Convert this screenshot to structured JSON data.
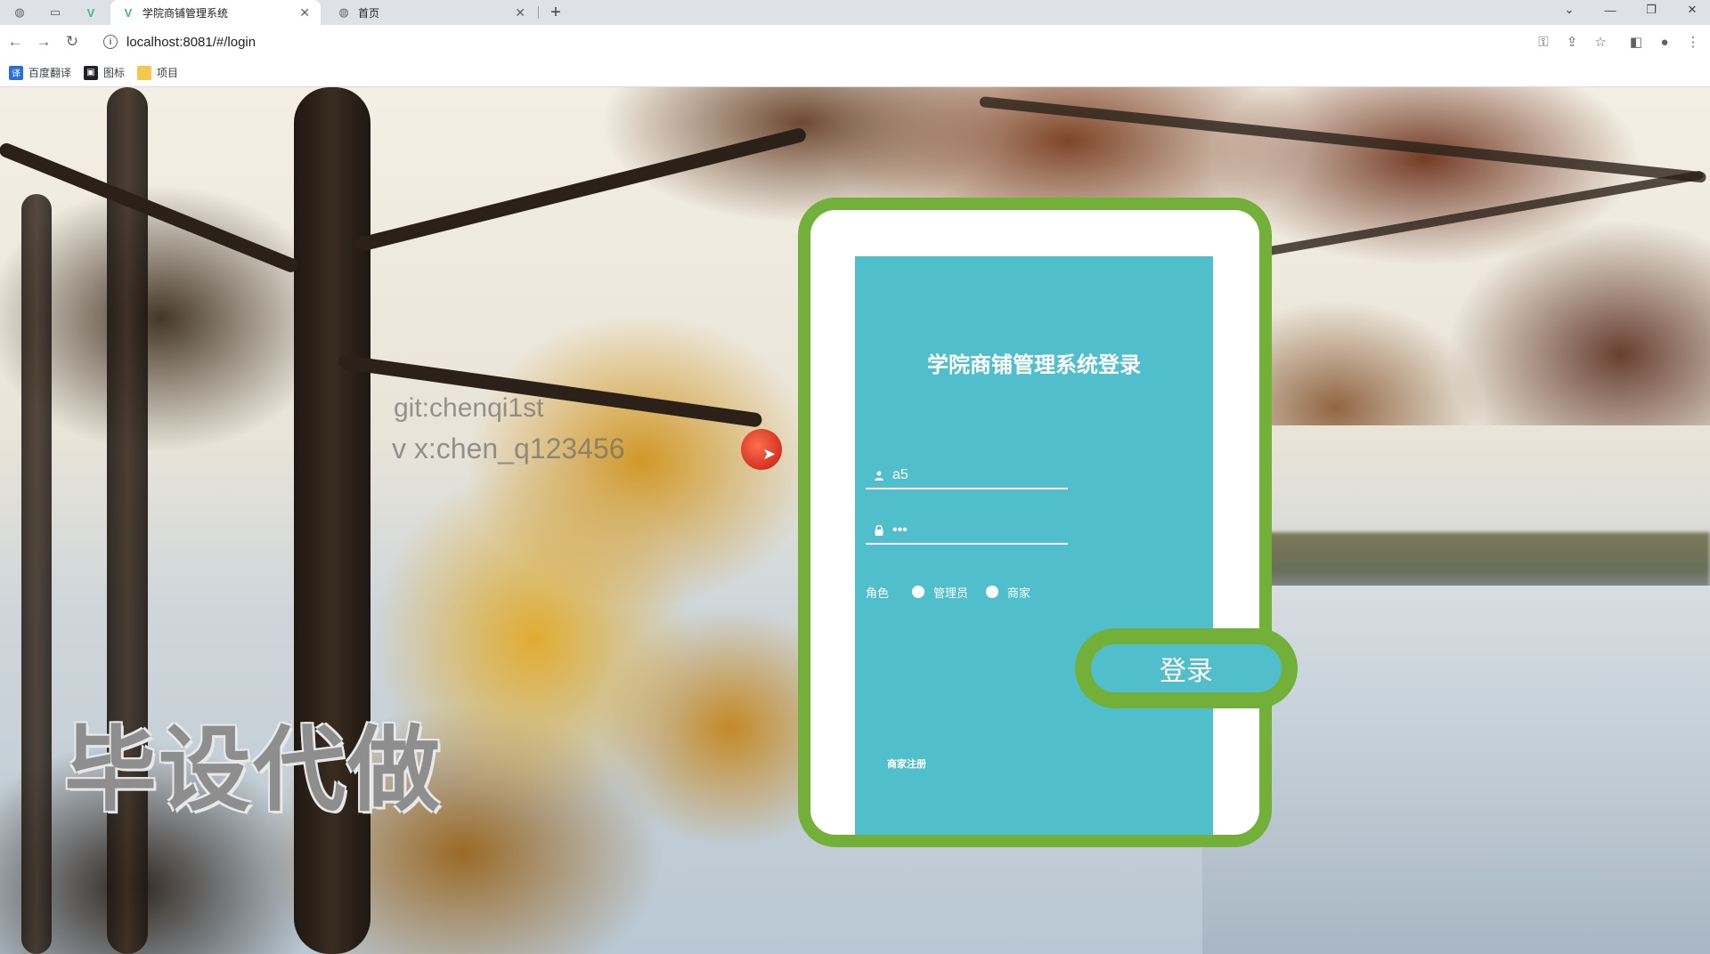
{
  "browser": {
    "tabs": [
      {
        "title": "学院商铺管理系统",
        "active": true
      },
      {
        "title": "首页",
        "active": false
      }
    ],
    "address": "localhost:8081/#/login",
    "bookmarks": [
      {
        "label": "百度翻译",
        "icon": "translate-icon",
        "color": "#2b6fd6"
      },
      {
        "label": "图标",
        "icon": "image-icon",
        "color": "#202124"
      },
      {
        "label": "项目",
        "icon": "folder-icon",
        "color": "#f2c94c"
      }
    ]
  },
  "watermark": {
    "line1": "git:chenqi1st",
    "line2": "v x:chen_q123456",
    "big": "毕设代做"
  },
  "login": {
    "title": "学院商铺管理系统登录",
    "username_value": "a5",
    "password_value": "123",
    "role_label": "角色",
    "roles": [
      "管理员",
      "商家"
    ],
    "submit_label": "登录",
    "register_label": "商家注册"
  },
  "colors": {
    "card_border": "#72b03a",
    "card_fill": "#51bfcb"
  }
}
